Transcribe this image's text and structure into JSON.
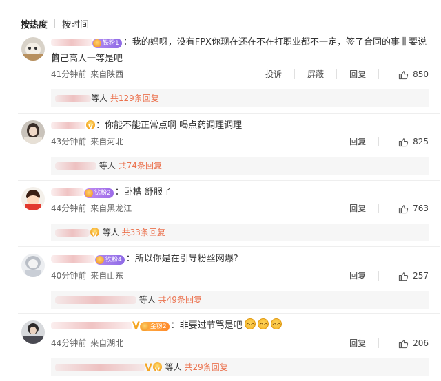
{
  "sort": {
    "hot": "按热度",
    "time": "按时间"
  },
  "colors": {
    "link": "#eb7350",
    "meta": "#666666",
    "reply_bg": "#f6f6f6"
  },
  "comments": [
    {
      "badge": "铁粉1",
      "text": "：我的妈呀，没有FPX你现在还在不在打职业都不一定，签了合同的事非要说的",
      "text2": "自己高人一等是吧",
      "time": "41分钟前",
      "location": "来自陕西",
      "actions": [
        "投诉",
        "屏蔽",
        "回复"
      ],
      "likes": "850",
      "reply_prefix": "等人",
      "reply_count": "共129条回复"
    },
    {
      "badge": "",
      "text": "：你能不能正常点啊 喝点药调理调理",
      "time": "43分钟前",
      "location": "来自河北",
      "reply_label": "回复",
      "likes": "825",
      "reply_prefix": "等人",
      "reply_count": "共74条回复"
    },
    {
      "badge": "钻粉2",
      "text": "：卧槽 舒服了",
      "time": "44分钟前",
      "location": "来自黑龙江",
      "reply_label": "回复",
      "likes": "763",
      "reply_prefix": "等人",
      "reply_count": "共33条回复"
    },
    {
      "badge": "铁粉4",
      "text": "：所以你是在引导粉丝网爆?",
      "time": "40分钟前",
      "location": "来自山东",
      "reply_label": "回复",
      "likes": "257",
      "reply_prefix": "等人",
      "reply_count": "共49条回复"
    },
    {
      "badge": "金粉2",
      "text": "：非要过节骂是吧",
      "time": "44分钟前",
      "location": "来自湖北",
      "reply_label": "回复",
      "likes": "206",
      "reply_prefix": "等人",
      "reply_count": "共29条回复"
    }
  ]
}
